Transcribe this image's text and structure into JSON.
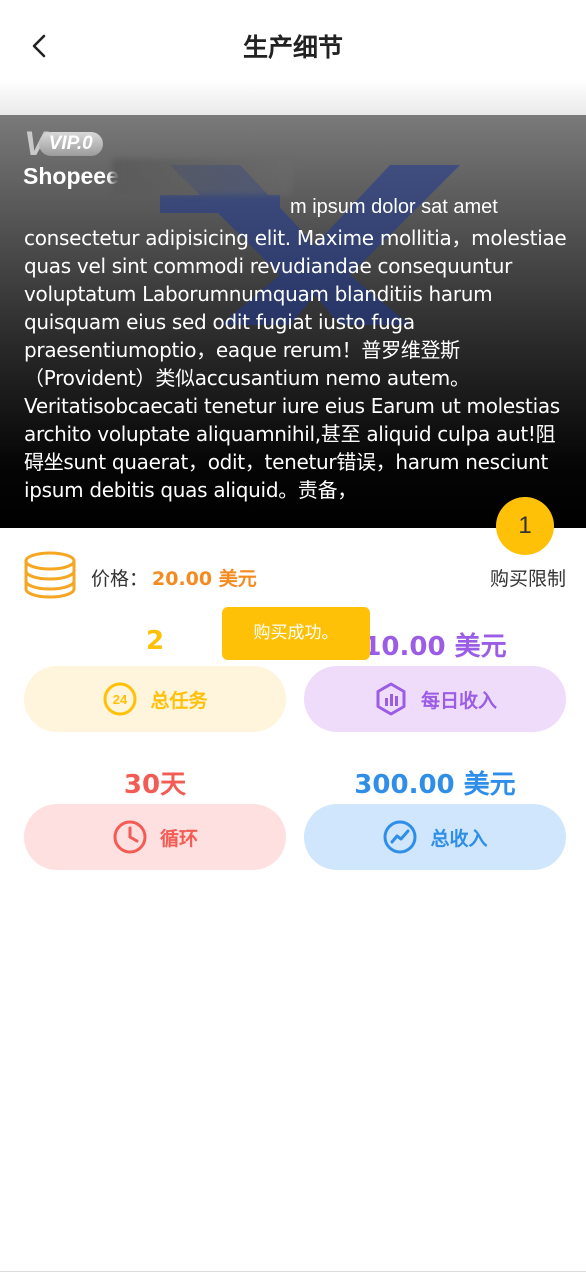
{
  "header": {
    "title": "生产细节"
  },
  "banner": {
    "vip_letter": "V",
    "vip_level": "VIP.0",
    "product_name": "Shopeee",
    "description_first": "m ipsum dolor sat amet",
    "description_body": "consectetur adipisicing elit. Maxime mollitia，molestiae quas vel sint commodi revudiandae consequuntur voluptatum Laborumnumquam blanditiis harum quisquam eius sed odit fugiat iusto fuga praesentiumoptio，eaque rerum！普罗维登斯（Provident）类似accusantium nemo autem。Veritatisobcaecati tenetur iure eius Earum ut molestias archito voluptate aliquamnihil,甚至 aliquid culpa aut!阻碍坐sunt quaerat，odit，tenetur错误，harum nesciunt ipsum debitis quas aliquid。责备，"
  },
  "purchase_limit": {
    "value": "1",
    "label": "购买限制"
  },
  "price": {
    "label": "价格：",
    "value": "20.00 美元"
  },
  "stats": {
    "total_tasks": {
      "value": "2",
      "label": "总任务",
      "icon_text": "24"
    },
    "daily_income": {
      "value": "10.00 美元",
      "label": "每日收入"
    },
    "cycle": {
      "value": "30天",
      "label": "循环"
    },
    "total_income": {
      "value": "300.00 美元",
      "label": "总收入"
    }
  },
  "toast": {
    "text": "购买成功。"
  },
  "colors": {
    "accent_yellow": "#ffc107",
    "price_orange": "#f58a1f",
    "purple": "#9b5de5",
    "red": "#f25c54",
    "blue": "#2f8fe8"
  }
}
